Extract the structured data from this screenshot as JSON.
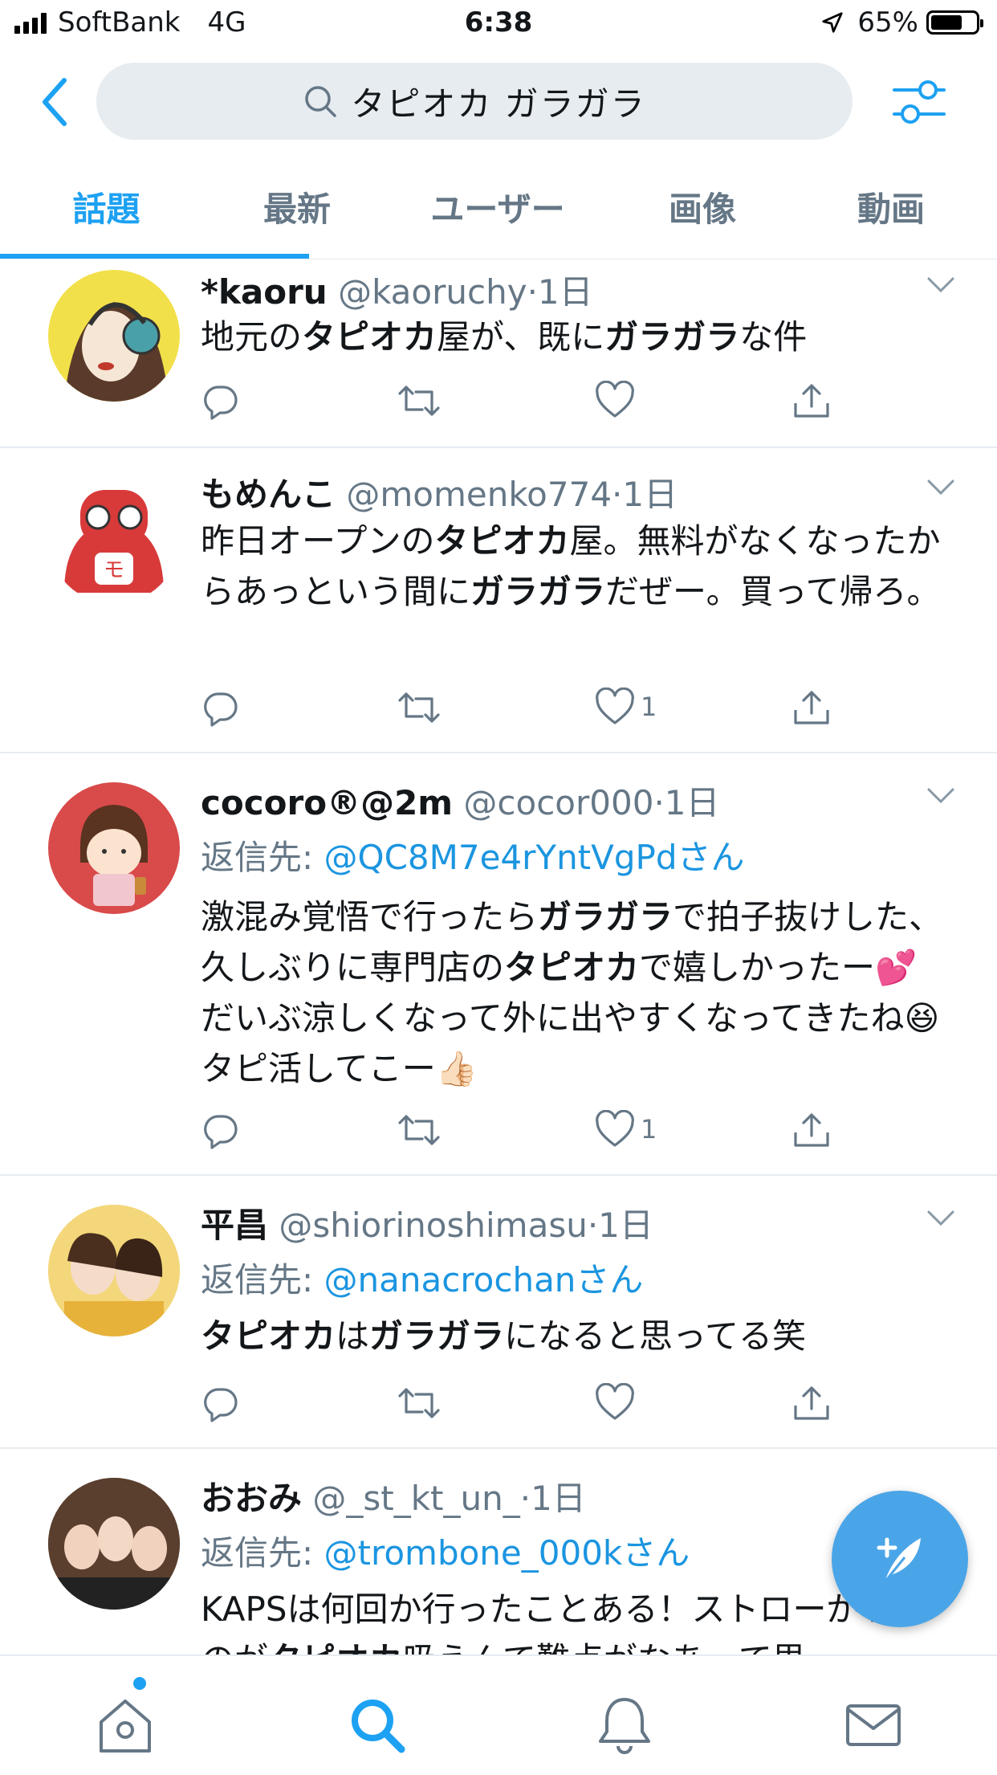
{
  "status_bar": {
    "carrier": "SoftBank",
    "network": "4G",
    "time": "6:38",
    "battery": "65%"
  },
  "search": {
    "query": "タピオカ ガラガラ"
  },
  "tabs": [
    {
      "label": "話題",
      "active": true
    },
    {
      "label": "最新"
    },
    {
      "label": "ユーザー"
    },
    {
      "label": "画像"
    },
    {
      "label": "動画"
    }
  ],
  "tweets": [
    {
      "name": "*kaoru",
      "handle": "@kaoruchy",
      "time": "·1日",
      "body": [
        {
          "t": "地元の"
        },
        {
          "t": "タピオカ",
          "b": true
        },
        {
          "t": "屋が、既に"
        },
        {
          "t": "ガラガラ",
          "b": true
        },
        {
          "t": "な件"
        }
      ],
      "likes": ""
    },
    {
      "name": "もめんこ",
      "handle": "@momenko774",
      "time": "·1日",
      "body": [
        {
          "t": "昨日オープンの"
        },
        {
          "t": "タピオカ",
          "b": true
        },
        {
          "t": "屋。無料がなくなったからあっという間に"
        },
        {
          "t": "ガラガラ",
          "b": true
        },
        {
          "t": "だぜー。買って帰ろ。"
        }
      ],
      "likes": "1"
    },
    {
      "name": "cocoro®@2m",
      "handle": "@cocor000",
      "time": "·1日",
      "reply_prefix": "返信先: ",
      "reply_to": "@QC8M7e4rYntVgPdさん",
      "body": [
        {
          "t": "激混み覚悟で行ったら"
        },
        {
          "t": "ガラガラ",
          "b": true
        },
        {
          "t": "で拍子抜けした、久しぶりに専門店の"
        },
        {
          "t": "タピオカ",
          "b": true
        },
        {
          "t": "で嬉しかったー💕 だいぶ涼しくなって外に出やすくなってきたね😆タピ活してこー👍🏻"
        }
      ],
      "likes": "1"
    },
    {
      "name": "平昌",
      "handle": "@shiorinoshimasu",
      "time": "·1日",
      "reply_prefix": "返信先: ",
      "reply_to": "@nanacrochanさん",
      "body": [
        {
          "t": "タピオカ",
          "b": true
        },
        {
          "t": "は"
        },
        {
          "t": "ガラガラ",
          "b": true
        },
        {
          "t": "になると思ってる笑"
        }
      ],
      "likes": ""
    },
    {
      "name": "おおみ",
      "handle": "@_st_kt_un_",
      "time": "·1日",
      "reply_prefix": "返信先: ",
      "reply_to": "@trombone_000kさん",
      "body": [
        {
          "t": "KAPSは何回か行ったことある！ストローがトなのが"
        },
        {
          "t": "タピオカ",
          "b": true
        },
        {
          "t": "吸えんて難点がなあ…て思"
        }
      ],
      "likes": ""
    }
  ]
}
